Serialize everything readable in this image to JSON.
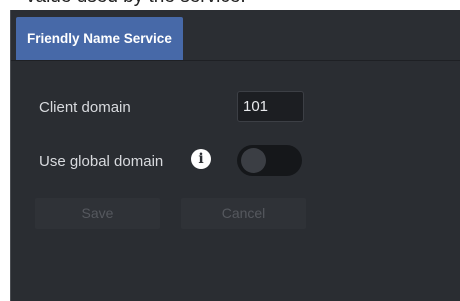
{
  "top_strip": {
    "partial_text": "value used by the service."
  },
  "tabs": [
    {
      "label": "Friendly Name Service",
      "active": true
    }
  ],
  "form": {
    "client_domain": {
      "label": "Client domain",
      "value": "101"
    },
    "use_global_domain": {
      "label": "Use global domain",
      "info_icon": "info-circle-icon",
      "toggle_on": false
    },
    "buttons": {
      "save_label": "Save",
      "cancel_label": "Cancel",
      "save_enabled": false,
      "cancel_enabled": false
    }
  },
  "colors": {
    "tab_active_bg": "#4769a8",
    "panel_bg": "#2a2d32",
    "toggle_off_bg": "#15171a",
    "label_text": "#d8dade"
  }
}
